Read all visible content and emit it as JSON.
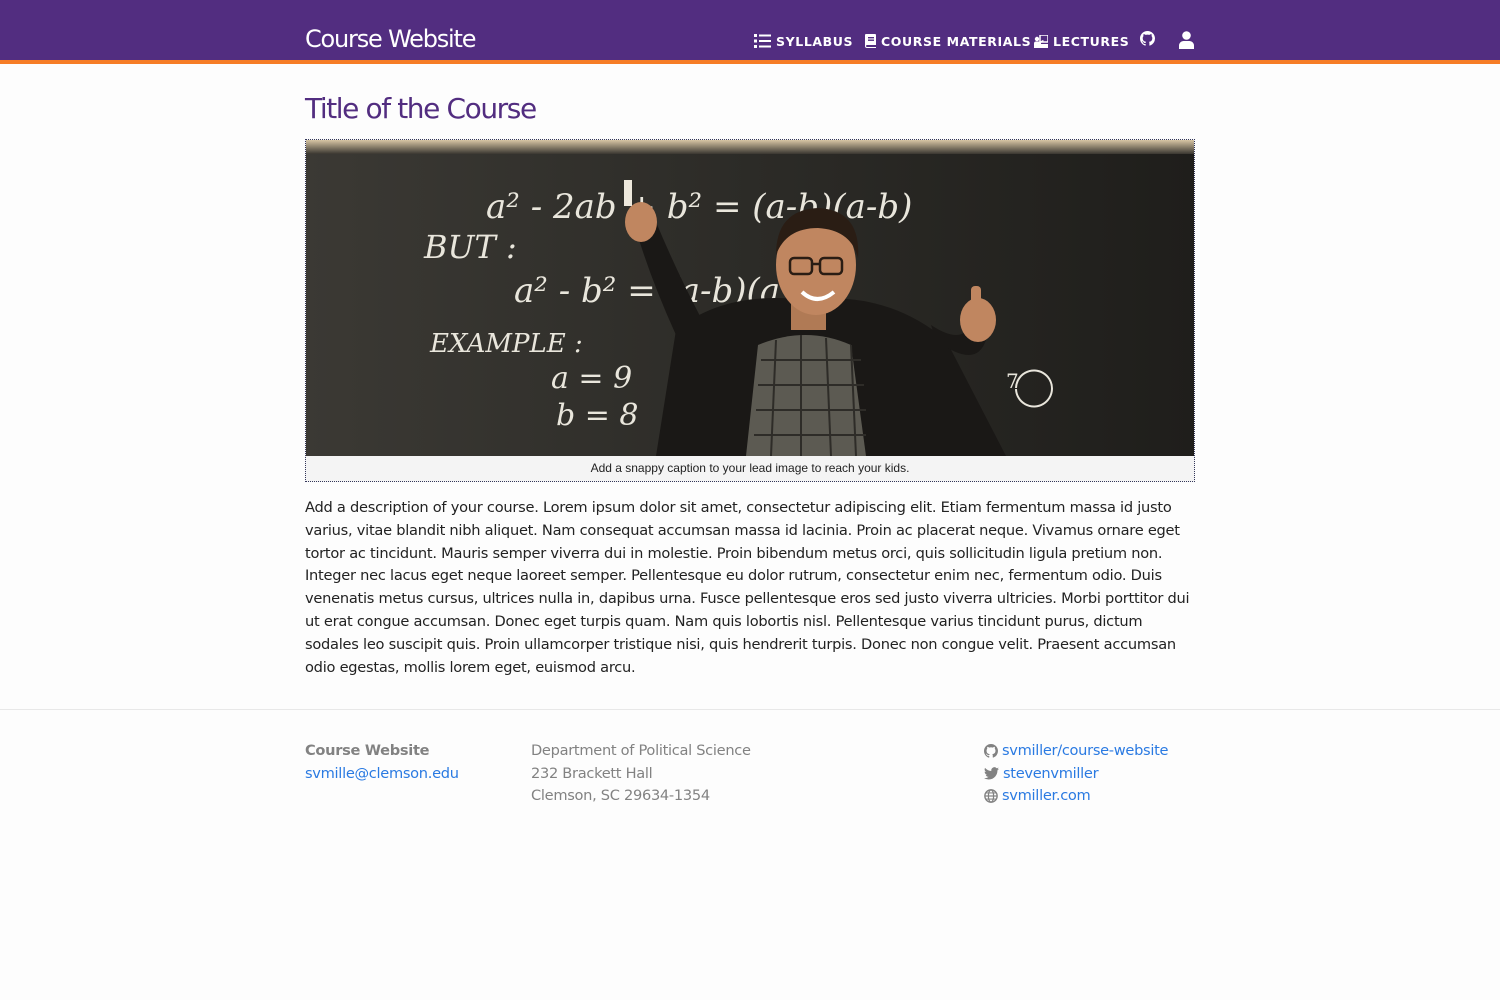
{
  "site": {
    "brand": "Course Website"
  },
  "nav": {
    "items": [
      {
        "label": "SYLLABUS",
        "icon": "list-icon"
      },
      {
        "label": "COURSE MATERIALS",
        "icon": "book-icon"
      },
      {
        "label": "LECTURES",
        "icon": "chalkboard-teacher-icon"
      }
    ],
    "github_icon": "github-icon",
    "user_icon": "user-icon"
  },
  "main": {
    "title": "Title of the Course",
    "image_caption": "Add a snappy caption to your lead image to reach your kids.",
    "description": "Add a description of your course. Lorem ipsum dolor sit amet, consectetur adipiscing elit. Etiam fermentum massa id justo varius, vitae blandit nibh aliquet. Nam consequat accumsan massa id lacinia. Proin ac placerat neque. Vivamus ornare eget tortor ac tincidunt. Mauris semper viverra dui in molestie. Proin bibendum metus orci, quis sollicitudin ligula pretium non. Integer nec lacus eget neque laoreet semper. Pellentesque eu dolor rutrum, consectetur enim nec, fermentum odio. Duis venenatis metus cursus, ultrices nulla in, dapibus urna. Fusce pellentesque eros sed justo viverra ultricies. Morbi porttitor dui ut erat congue accumsan. Donec eget turpis quam. Nam quis lobortis nisl. Pellentesque varius tincidunt purus, dictum sodales leo suscipit quis. Proin ullamcorper tristique nisi, quis hendrerit turpis. Donec non congue velit. Praesent accumsan odio egestas, mollis lorem eget, euismod arcu.",
    "chalkboard_text": {
      "line1": "a² - 2ab + b² = (a-b)(a-b)",
      "line2": "BUT :",
      "line3": "a² - b² = (a-b)(a+b)",
      "line4": "EXAMPLE :",
      "line5": "a = 9",
      "line6": "b = 8"
    }
  },
  "footer": {
    "name": "Course Website",
    "email": "svmille@clemson.edu",
    "address": [
      "Department of Political Science",
      "232 Brackett Hall",
      "Clemson, SC 29634-1354"
    ],
    "social": [
      {
        "icon": "github-icon",
        "label": "svmiller/course-website"
      },
      {
        "icon": "twitter-icon",
        "label": "stevenvmiller"
      },
      {
        "icon": "globe-icon",
        "label": "svmiller.com"
      }
    ]
  },
  "colors": {
    "navbar": "#522d80",
    "accent": "#f56600",
    "link": "#2a7ae2",
    "muted": "#828282"
  }
}
